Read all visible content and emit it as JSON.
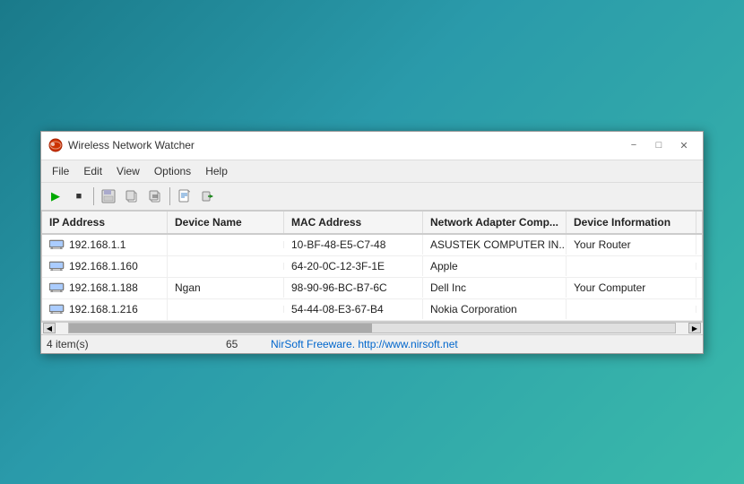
{
  "window": {
    "title": "Wireless Network Watcher",
    "minimize_label": "−",
    "maximize_label": "□",
    "close_label": "✕"
  },
  "menu": {
    "items": [
      "File",
      "Edit",
      "View",
      "Options",
      "Help"
    ]
  },
  "toolbar": {
    "buttons": [
      {
        "name": "play",
        "icon": "▶",
        "label": "Start"
      },
      {
        "name": "stop",
        "icon": "■",
        "label": "Stop"
      },
      {
        "name": "save",
        "icon": "💾",
        "label": "Save"
      },
      {
        "name": "copy",
        "icon": "📋",
        "label": "Copy"
      },
      {
        "name": "copy2",
        "icon": "📄",
        "label": "Copy2"
      },
      {
        "name": "report",
        "icon": "📊",
        "label": "Report"
      },
      {
        "name": "exit",
        "icon": "🚪",
        "label": "Exit"
      }
    ]
  },
  "table": {
    "columns": [
      "IP Address",
      "Device Name",
      "MAC Address",
      "Network Adapter Comp...",
      "Device Information"
    ],
    "rows": [
      {
        "ip": "192.168.1.1",
        "name": "",
        "mac": "10-BF-48-E5-C7-48",
        "adapter": "ASUSTEK COMPUTER IN...",
        "info": "Your Router"
      },
      {
        "ip": "192.168.1.160",
        "name": "",
        "mac": "64-20-0C-12-3F-1E",
        "adapter": "Apple",
        "info": ""
      },
      {
        "ip": "192.168.1.188",
        "name": "Ngan",
        "mac": "98-90-96-BC-B7-6C",
        "adapter": "Dell Inc",
        "info": "Your Computer"
      },
      {
        "ip": "192.168.1.216",
        "name": "",
        "mac": "54-44-08-E3-67-B4",
        "adapter": "Nokia Corporation",
        "info": ""
      }
    ]
  },
  "status": {
    "item_count": "4 item(s)",
    "number": "65",
    "freeware_text": "NirSoft Freeware.  http://www.nirsoft.net"
  }
}
